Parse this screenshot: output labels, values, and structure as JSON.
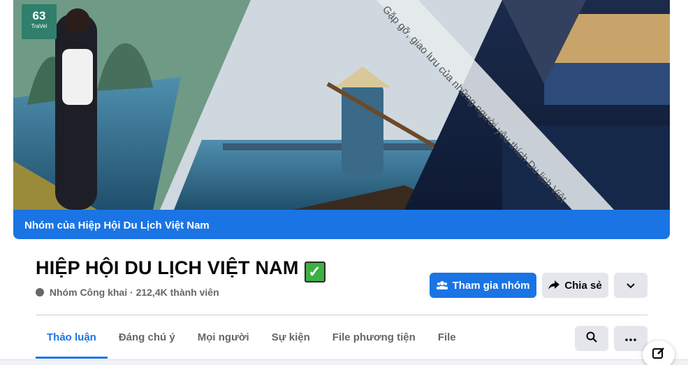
{
  "cover": {
    "logo_number": "63",
    "logo_word": "TraVel",
    "overlay_text": "Gặp gỡ, giao lưu của những người yêu thích Du lịch Việt",
    "banner_text": "Nhóm của Hiệp Hội Du Lịch Việt Nam"
  },
  "group": {
    "title": "HIỆP HỘI DU LỊCH VIỆT NAM",
    "verified_mark": "✓",
    "privacy": "Nhóm Công khai",
    "separator": "·",
    "members": "212,4K thành viên"
  },
  "actions": {
    "join_label": "Tham gia nhóm",
    "share_label": "Chia sẻ"
  },
  "tabs": [
    {
      "label": "Thảo luận",
      "active": true
    },
    {
      "label": "Đáng chú ý",
      "active": false
    },
    {
      "label": "Mọi người",
      "active": false
    },
    {
      "label": "Sự kiện",
      "active": false
    },
    {
      "label": "File phương tiện",
      "active": false
    },
    {
      "label": "File",
      "active": false
    }
  ],
  "icons": {
    "join": "people-icon",
    "share": "share-arrow-icon",
    "more": "chevron-down-icon",
    "search": "search-icon",
    "tab_more": "ellipsis-icon",
    "compose": "compose-icon",
    "privacy": "globe-icon"
  },
  "colors": {
    "accent": "#1b74e4",
    "secondary_button": "#e4e6eb",
    "muted_text": "#65676b",
    "verified": "#3cb043"
  }
}
